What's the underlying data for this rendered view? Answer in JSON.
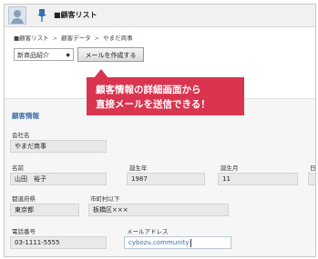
{
  "header": {
    "title": "■顧客リスト"
  },
  "breadcrumb": {
    "items": [
      "■顧客リスト",
      "顧客データ",
      "やまだ商事"
    ],
    "separator": ">"
  },
  "toolbar": {
    "select_value": "新商品紹介",
    "create_button_label": "メールを作成する"
  },
  "callout": {
    "line1": "顧客情報の詳細画面から",
    "line2": "直接メールを送信できる！"
  },
  "section": {
    "title": "顧客情報"
  },
  "form": {
    "company": {
      "label": "会社名",
      "value": "やまだ商事"
    },
    "name": {
      "label": "名前",
      "value": "山田　裕子"
    },
    "birth_year": {
      "label": "誕生年",
      "value": "1987"
    },
    "birth_month": {
      "label": "誕生月",
      "value": "11"
    },
    "birth_day": {
      "label": "日"
    },
    "prefecture": {
      "label": "都道府県",
      "value": "東京都"
    },
    "city": {
      "label": "市町村以下",
      "value": "板橋区×××"
    },
    "phone": {
      "label": "電話番号",
      "value": "03-1111-5555"
    },
    "email": {
      "label": "メールアドレス",
      "value": "cybozu.community"
    }
  },
  "colors": {
    "accent": "#d93550",
    "section_title": "#3f6fa8"
  }
}
